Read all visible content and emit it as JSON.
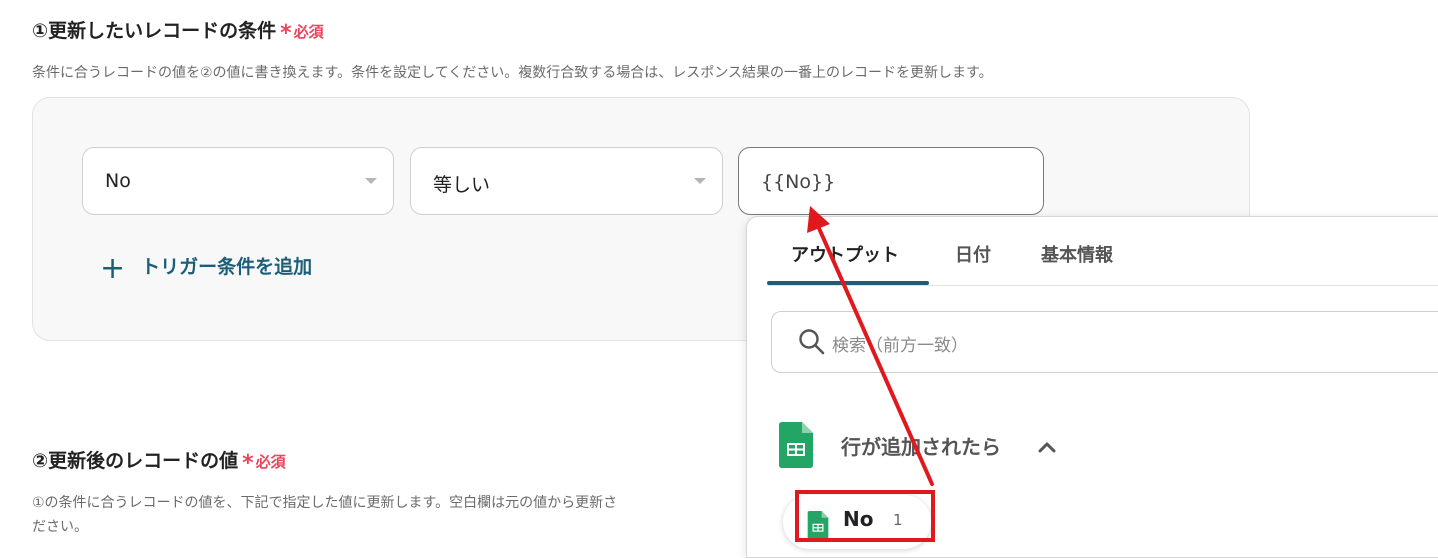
{
  "section1": {
    "title": "①更新したいレコードの条件",
    "required_label": "必須",
    "required_star": "*",
    "description": "条件に合うレコードの値を②の値に書き換えます。条件を設定してください。複数行合致する場合は、レスポンス結果の一番上のレコードを更新します。",
    "field_select_value": "No",
    "operator_select_value": "等しい",
    "value_input": "{{No}}",
    "add_trigger_plus": "+",
    "add_trigger_label": "トリガー条件を追加"
  },
  "section2": {
    "title": "②更新後のレコードの値",
    "required_label": "必須",
    "required_star": "*",
    "description_line1": "①の条件に合うレコードの値を、下記で指定した値に更新します。空白欄は元の値から更新さ",
    "description_line2": "ださい。"
  },
  "popup": {
    "tabs": [
      "アウトプット",
      "日付",
      "基本情報"
    ],
    "active_tab": "アウトプット",
    "search_placeholder": "検索（前方一致）",
    "group_label": "行が追加されたら",
    "item_name": "No",
    "item_count": "1"
  },
  "colors": {
    "accent": "#1b5e78",
    "required": "#e8445a",
    "annotation_red": "#e0191f",
    "sheets_green": "#23a566"
  },
  "icons": [
    "search-icon",
    "google-sheets-icon",
    "chevron-up-icon",
    "plus-icon",
    "dropdown-caret-icon"
  ]
}
